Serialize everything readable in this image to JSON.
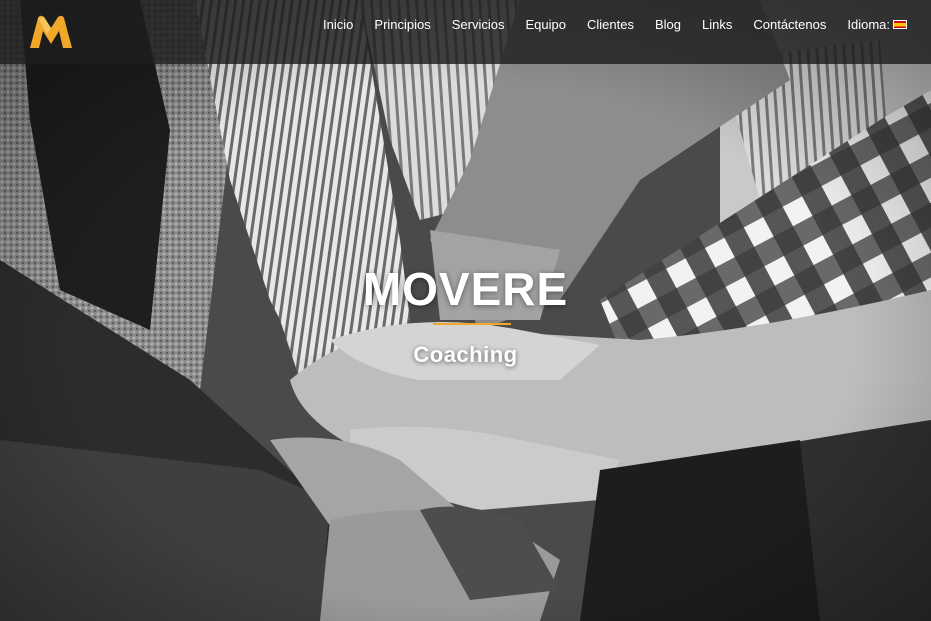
{
  "brand": {
    "logo_icon": "movere-m-logo",
    "accent_color": "#f1a82a"
  },
  "nav": {
    "items": [
      {
        "label": "Inicio"
      },
      {
        "label": "Principios"
      },
      {
        "label": "Servicios"
      },
      {
        "label": "Equipo"
      },
      {
        "label": "Clientes"
      },
      {
        "label": "Blog"
      },
      {
        "label": "Links"
      },
      {
        "label": "Contáctenos"
      },
      {
        "label": "Idioma:"
      }
    ],
    "language_flag_icon": "spain-flag-icon"
  },
  "hero": {
    "title": "MOVERE",
    "subtitle": "Coaching",
    "background_image": "team-hands-stacked-photo"
  }
}
